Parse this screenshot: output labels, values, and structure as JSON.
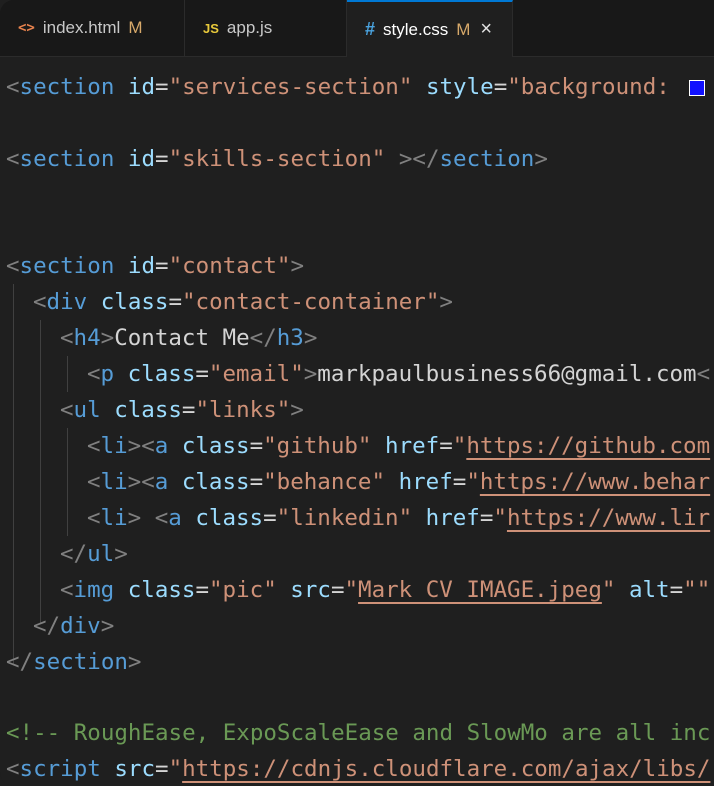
{
  "tabs": [
    {
      "icon": "<>",
      "label": "index.html",
      "modified": "M"
    },
    {
      "icon": "JS",
      "label": "app.js"
    },
    {
      "icon": "#",
      "label": "style.css",
      "modified": "M",
      "close": "×"
    }
  ],
  "code": {
    "l1": {
      "lt": "<",
      "tag": "section",
      "sp1": " ",
      "attr1": "id",
      "eq1": "=",
      "val1": "\"services-section\"",
      "sp2": " ",
      "attr2": "style",
      "eq2": "=",
      "val2": "\"background: "
    },
    "l2": {
      "lt": "<",
      "tag": "section",
      "sp1": " ",
      "attr1": "id",
      "eq1": "=",
      "val1": "\"skills-section\"",
      "sp2": " ",
      "gt": ">",
      "lt2": "</",
      "tag2": "section",
      "gt2": ">"
    },
    "l3": {
      "lt": "<",
      "tag": "section",
      "sp1": " ",
      "attr1": "id",
      "eq1": "=",
      "val1": "\"contact\"",
      "gt": ">"
    },
    "l4": {
      "lt": "<",
      "tag": "div",
      "sp1": " ",
      "attr1": "class",
      "eq1": "=",
      "val1": "\"contact-container\"",
      "gt": ">"
    },
    "l5": {
      "lt": "<",
      "tag": "h4",
      "gt": ">",
      "text": "Contact Me",
      "lt2": "</",
      "tag2": "h3",
      "gt2": ">"
    },
    "l6": {
      "lt": "<",
      "tag": "p",
      "sp1": " ",
      "attr1": "class",
      "eq1": "=",
      "val1": "\"email\"",
      "gt": ">",
      "text": "markpaulbusiness66@gmail.com",
      "lt2": "<"
    },
    "l7": {
      "lt": "<",
      "tag": "ul",
      "sp1": " ",
      "attr1": "class",
      "eq1": "=",
      "val1": "\"links\"",
      "gt": ">"
    },
    "l8": {
      "lt": "<",
      "tag": "li",
      "gt": ">",
      "lt2": "<",
      "tag2": "a",
      "sp1": " ",
      "attr1": "class",
      "eq1": "=",
      "val1": "\"github\"",
      "sp2": " ",
      "attr2": "href",
      "eq2": "=",
      "q": "\"",
      "url": "https://github.com"
    },
    "l9": {
      "lt": "<",
      "tag": "li",
      "gt": ">",
      "lt2": "<",
      "tag2": "a",
      "sp1": " ",
      "attr1": "class",
      "eq1": "=",
      "val1": "\"behance\"",
      "sp2": " ",
      "attr2": "href",
      "eq2": "=",
      "q": "\"",
      "url": "https://www.behar"
    },
    "l10": {
      "lt": "<",
      "tag": "li",
      "gt": ">",
      "sp0": " ",
      "lt2": "<",
      "tag2": "a",
      "sp1": " ",
      "attr1": "class",
      "eq1": "=",
      "val1": "\"linkedin\"",
      "sp2": " ",
      "attr2": "href",
      "eq2": "=",
      "q": "\"",
      "url": "https://www.lir"
    },
    "l11": {
      "lt": "</",
      "tag": "ul",
      "gt": ">"
    },
    "l12": {
      "lt": "<",
      "tag": "img",
      "sp1": " ",
      "attr1": "class",
      "eq1": "=",
      "val1": "\"pic\"",
      "sp2": " ",
      "attr2": "src",
      "eq2": "=",
      "q": "\"",
      "file": "Mark CV IMAGE.jpeg",
      "q2": "\"",
      "sp3": " ",
      "attr3": "alt",
      "eq3": "=",
      "val3": "\"\""
    },
    "l13": {
      "lt": "</",
      "tag": "div",
      "gt": ">"
    },
    "l14": {
      "lt": "</",
      "tag": "section",
      "gt": ">"
    },
    "l15": {
      "comment": "<!-- RoughEase, ExpoScaleEase and SlowMo are all inc"
    },
    "l16": {
      "lt": "<",
      "tag": "script",
      "sp1": " ",
      "attr1": "src",
      "eq1": "=",
      "q": "\"",
      "url": "https://cdnjs.cloudflare.com/ajax/libs/"
    }
  },
  "colors": {
    "swatch": "#1010ff",
    "accent": "#0078d4"
  }
}
